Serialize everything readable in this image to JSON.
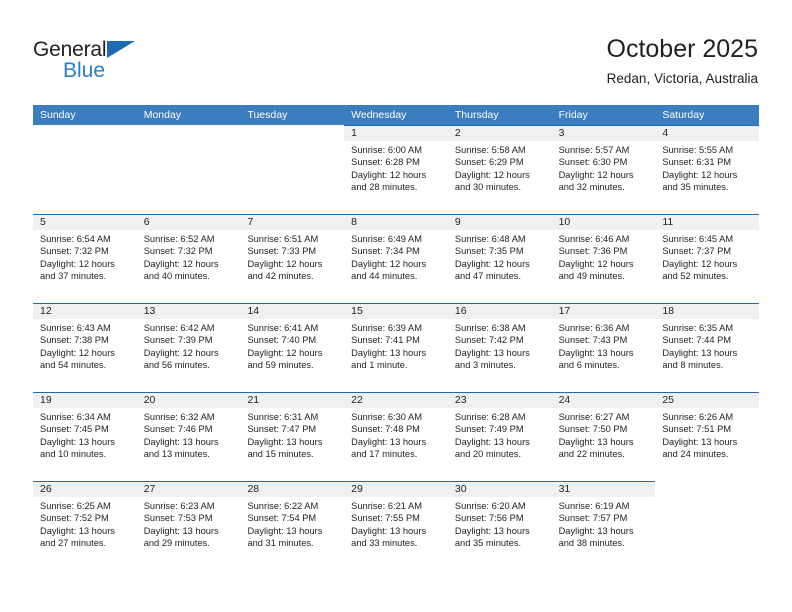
{
  "brand": {
    "name_top": "General",
    "name_bottom": "Blue",
    "triangle_color": "#1b6cb5",
    "blue_text_color": "#2a7fc9"
  },
  "header": {
    "title": "October 2025",
    "location": "Redan, Victoria, Australia"
  },
  "theme": {
    "header_blue": "#3b7dbf",
    "row_rule_blue": "#1b6cb5",
    "daynum_band": "#f0f0f0",
    "text": "#231f20"
  },
  "weekdays": [
    "Sunday",
    "Monday",
    "Tuesday",
    "Wednesday",
    "Thursday",
    "Friday",
    "Saturday"
  ],
  "weeks": [
    [
      {
        "empty": true
      },
      {
        "empty": true
      },
      {
        "empty": true
      },
      {
        "day": "1",
        "sunrise": "Sunrise: 6:00 AM",
        "sunset": "Sunset: 6:28 PM",
        "daylight_line1": "Daylight: 12 hours",
        "daylight_line2": "and 28 minutes."
      },
      {
        "day": "2",
        "sunrise": "Sunrise: 5:58 AM",
        "sunset": "Sunset: 6:29 PM",
        "daylight_line1": "Daylight: 12 hours",
        "daylight_line2": "and 30 minutes."
      },
      {
        "day": "3",
        "sunrise": "Sunrise: 5:57 AM",
        "sunset": "Sunset: 6:30 PM",
        "daylight_line1": "Daylight: 12 hours",
        "daylight_line2": "and 32 minutes."
      },
      {
        "day": "4",
        "sunrise": "Sunrise: 5:55 AM",
        "sunset": "Sunset: 6:31 PM",
        "daylight_line1": "Daylight: 12 hours",
        "daylight_line2": "and 35 minutes."
      }
    ],
    [
      {
        "day": "5",
        "sunrise": "Sunrise: 6:54 AM",
        "sunset": "Sunset: 7:32 PM",
        "daylight_line1": "Daylight: 12 hours",
        "daylight_line2": "and 37 minutes."
      },
      {
        "day": "6",
        "sunrise": "Sunrise: 6:52 AM",
        "sunset": "Sunset: 7:32 PM",
        "daylight_line1": "Daylight: 12 hours",
        "daylight_line2": "and 40 minutes."
      },
      {
        "day": "7",
        "sunrise": "Sunrise: 6:51 AM",
        "sunset": "Sunset: 7:33 PM",
        "daylight_line1": "Daylight: 12 hours",
        "daylight_line2": "and 42 minutes."
      },
      {
        "day": "8",
        "sunrise": "Sunrise: 6:49 AM",
        "sunset": "Sunset: 7:34 PM",
        "daylight_line1": "Daylight: 12 hours",
        "daylight_line2": "and 44 minutes."
      },
      {
        "day": "9",
        "sunrise": "Sunrise: 6:48 AM",
        "sunset": "Sunset: 7:35 PM",
        "daylight_line1": "Daylight: 12 hours",
        "daylight_line2": "and 47 minutes."
      },
      {
        "day": "10",
        "sunrise": "Sunrise: 6:46 AM",
        "sunset": "Sunset: 7:36 PM",
        "daylight_line1": "Daylight: 12 hours",
        "daylight_line2": "and 49 minutes."
      },
      {
        "day": "11",
        "sunrise": "Sunrise: 6:45 AM",
        "sunset": "Sunset: 7:37 PM",
        "daylight_line1": "Daylight: 12 hours",
        "daylight_line2": "and 52 minutes."
      }
    ],
    [
      {
        "day": "12",
        "sunrise": "Sunrise: 6:43 AM",
        "sunset": "Sunset: 7:38 PM",
        "daylight_line1": "Daylight: 12 hours",
        "daylight_line2": "and 54 minutes."
      },
      {
        "day": "13",
        "sunrise": "Sunrise: 6:42 AM",
        "sunset": "Sunset: 7:39 PM",
        "daylight_line1": "Daylight: 12 hours",
        "daylight_line2": "and 56 minutes."
      },
      {
        "day": "14",
        "sunrise": "Sunrise: 6:41 AM",
        "sunset": "Sunset: 7:40 PM",
        "daylight_line1": "Daylight: 12 hours",
        "daylight_line2": "and 59 minutes."
      },
      {
        "day": "15",
        "sunrise": "Sunrise: 6:39 AM",
        "sunset": "Sunset: 7:41 PM",
        "daylight_line1": "Daylight: 13 hours",
        "daylight_line2": "and 1 minute."
      },
      {
        "day": "16",
        "sunrise": "Sunrise: 6:38 AM",
        "sunset": "Sunset: 7:42 PM",
        "daylight_line1": "Daylight: 13 hours",
        "daylight_line2": "and 3 minutes."
      },
      {
        "day": "17",
        "sunrise": "Sunrise: 6:36 AM",
        "sunset": "Sunset: 7:43 PM",
        "daylight_line1": "Daylight: 13 hours",
        "daylight_line2": "and 6 minutes."
      },
      {
        "day": "18",
        "sunrise": "Sunrise: 6:35 AM",
        "sunset": "Sunset: 7:44 PM",
        "daylight_line1": "Daylight: 13 hours",
        "daylight_line2": "and 8 minutes."
      }
    ],
    [
      {
        "day": "19",
        "sunrise": "Sunrise: 6:34 AM",
        "sunset": "Sunset: 7:45 PM",
        "daylight_line1": "Daylight: 13 hours",
        "daylight_line2": "and 10 minutes."
      },
      {
        "day": "20",
        "sunrise": "Sunrise: 6:32 AM",
        "sunset": "Sunset: 7:46 PM",
        "daylight_line1": "Daylight: 13 hours",
        "daylight_line2": "and 13 minutes."
      },
      {
        "day": "21",
        "sunrise": "Sunrise: 6:31 AM",
        "sunset": "Sunset: 7:47 PM",
        "daylight_line1": "Daylight: 13 hours",
        "daylight_line2": "and 15 minutes."
      },
      {
        "day": "22",
        "sunrise": "Sunrise: 6:30 AM",
        "sunset": "Sunset: 7:48 PM",
        "daylight_line1": "Daylight: 13 hours",
        "daylight_line2": "and 17 minutes."
      },
      {
        "day": "23",
        "sunrise": "Sunrise: 6:28 AM",
        "sunset": "Sunset: 7:49 PM",
        "daylight_line1": "Daylight: 13 hours",
        "daylight_line2": "and 20 minutes."
      },
      {
        "day": "24",
        "sunrise": "Sunrise: 6:27 AM",
        "sunset": "Sunset: 7:50 PM",
        "daylight_line1": "Daylight: 13 hours",
        "daylight_line2": "and 22 minutes."
      },
      {
        "day": "25",
        "sunrise": "Sunrise: 6:26 AM",
        "sunset": "Sunset: 7:51 PM",
        "daylight_line1": "Daylight: 13 hours",
        "daylight_line2": "and 24 minutes."
      }
    ],
    [
      {
        "day": "26",
        "sunrise": "Sunrise: 6:25 AM",
        "sunset": "Sunset: 7:52 PM",
        "daylight_line1": "Daylight: 13 hours",
        "daylight_line2": "and 27 minutes."
      },
      {
        "day": "27",
        "sunrise": "Sunrise: 6:23 AM",
        "sunset": "Sunset: 7:53 PM",
        "daylight_line1": "Daylight: 13 hours",
        "daylight_line2": "and 29 minutes."
      },
      {
        "day": "28",
        "sunrise": "Sunrise: 6:22 AM",
        "sunset": "Sunset: 7:54 PM",
        "daylight_line1": "Daylight: 13 hours",
        "daylight_line2": "and 31 minutes."
      },
      {
        "day": "29",
        "sunrise": "Sunrise: 6:21 AM",
        "sunset": "Sunset: 7:55 PM",
        "daylight_line1": "Daylight: 13 hours",
        "daylight_line2": "and 33 minutes."
      },
      {
        "day": "30",
        "sunrise": "Sunrise: 6:20 AM",
        "sunset": "Sunset: 7:56 PM",
        "daylight_line1": "Daylight: 13 hours",
        "daylight_line2": "and 35 minutes."
      },
      {
        "day": "31",
        "sunrise": "Sunrise: 6:19 AM",
        "sunset": "Sunset: 7:57 PM",
        "daylight_line1": "Daylight: 13 hours",
        "daylight_line2": "and 38 minutes."
      },
      {
        "empty": true
      }
    ]
  ]
}
